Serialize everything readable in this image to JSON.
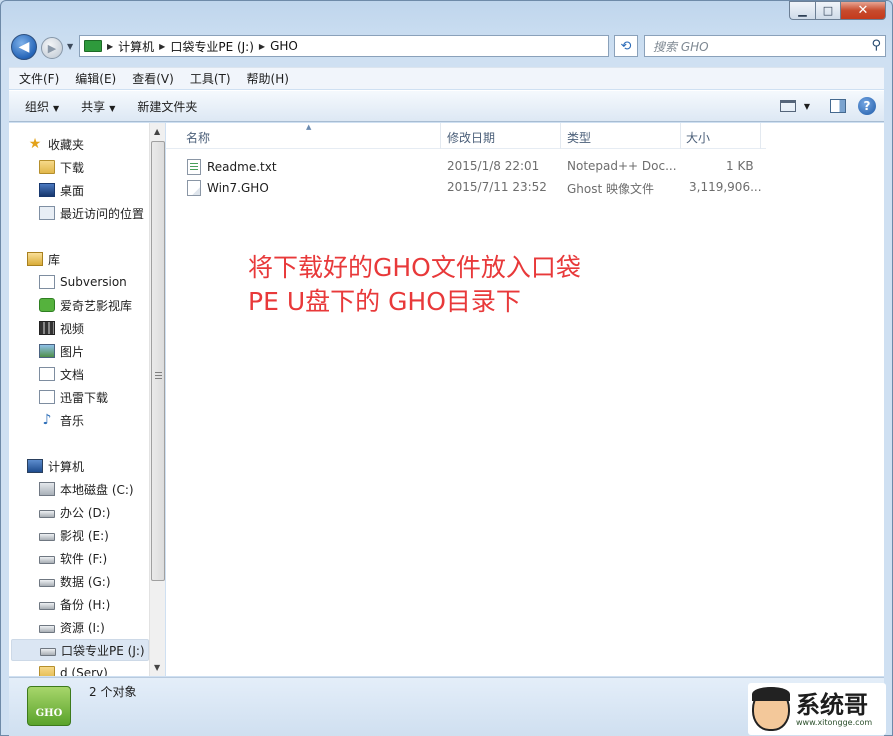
{
  "window": {
    "caption": {
      "minimize": "▁",
      "maximize": "□",
      "close": "✕"
    }
  },
  "address_bar": {
    "breadcrumbs": [
      "计算机",
      "口袋专业PE (J:)",
      "GHO"
    ],
    "search_placeholder": "搜索 GHO"
  },
  "menubar": {
    "items": [
      "文件(F)",
      "编辑(E)",
      "查看(V)",
      "工具(T)",
      "帮助(H)"
    ]
  },
  "commandbar": {
    "organize": "组织",
    "share": "共享",
    "new_folder": "新建文件夹"
  },
  "navpane": {
    "items": [
      {
        "label": "收藏夹",
        "icon": "star-icon"
      },
      {
        "label": "下载",
        "icon": "downloads-folder-icon"
      },
      {
        "label": "桌面",
        "icon": "desktop-icon"
      },
      {
        "label": "最近访问的位置",
        "icon": "recent-places-icon"
      },
      {
        "label": "库",
        "icon": "library-icon"
      },
      {
        "label": "Subversion",
        "icon": "document-library-icon"
      },
      {
        "label": "爱奇艺影视库",
        "icon": "iqiyi-icon"
      },
      {
        "label": "视频",
        "icon": "video-library-icon"
      },
      {
        "label": "图片",
        "icon": "picture-library-icon"
      },
      {
        "label": "文档",
        "icon": "document-library-icon"
      },
      {
        "label": "迅雷下载",
        "icon": "document-library-icon"
      },
      {
        "label": "音乐",
        "icon": "music-library-icon"
      },
      {
        "label": "计算机",
        "icon": "computer-icon"
      },
      {
        "label": "本地磁盘 (C:)",
        "icon": "system-drive-icon"
      },
      {
        "label": "办公 (D:)",
        "icon": "drive-icon"
      },
      {
        "label": "影视 (E:)",
        "icon": "drive-icon"
      },
      {
        "label": "软件 (F:)",
        "icon": "drive-icon"
      },
      {
        "label": "数据 (G:)",
        "icon": "drive-icon"
      },
      {
        "label": "备份 (H:)",
        "icon": "drive-icon"
      },
      {
        "label": "资源 (I:)",
        "icon": "drive-icon"
      },
      {
        "label": "口袋专业PE (J:)",
        "icon": "usb-drive-icon"
      },
      {
        "label": "d (Serv)",
        "icon": "network-folder-icon"
      }
    ]
  },
  "filelist": {
    "columns": [
      "名称",
      "修改日期",
      "类型",
      "大小"
    ],
    "rows": [
      {
        "name": "Readme.txt",
        "date": "2015/1/8 22:01",
        "type": "Notepad++ Doc...",
        "size": "1 KB",
        "icon": "text-file-icon"
      },
      {
        "name": "Win7.GHO",
        "date": "2015/7/11 23:52",
        "type": "Ghost 映像文件",
        "size": "3,119,906...",
        "icon": "gho-file-icon"
      }
    ]
  },
  "annotation": {
    "line1": "将下载好的GHO文件放入口袋",
    "line2": "PE U盘下的 GHO目录下"
  },
  "statusbar": {
    "icon_label": "GHO",
    "count_text": "2 个对象"
  },
  "watermark": {
    "title": "系统哥",
    "url": "www.xitongge.com"
  }
}
